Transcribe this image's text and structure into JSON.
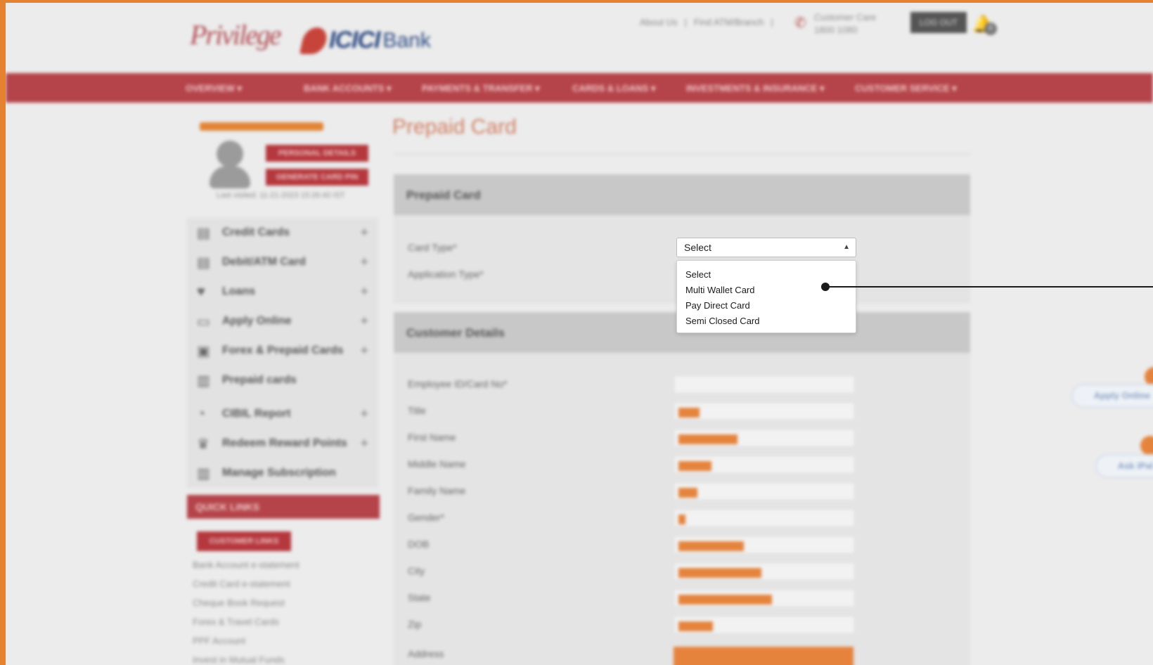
{
  "header": {
    "logo_privilege": "Privilege",
    "logo_bank": "ICICI",
    "logo_bank_suffix": "Bank",
    "about_link": "About Us",
    "find_link": "Find ATM/Branch",
    "care_label": "Customer Care",
    "care_number": "1800 1080",
    "logout_label": "LOG OUT",
    "notification_count": "0"
  },
  "nav": {
    "items": [
      {
        "label": "OVERVIEW ▾"
      },
      {
        "label": "BANK ACCOUNTS ▾"
      },
      {
        "label": "PAYMENTS & TRANSFER ▾"
      },
      {
        "label": "CARDS & LOANS ▾"
      },
      {
        "label": "INVESTMENTS & INSURANCE ▾"
      },
      {
        "label": "CUSTOMER SERVICE ▾"
      }
    ]
  },
  "profile": {
    "personal_details_label": "PERSONAL DETAILS",
    "generate_pin_label": "GENERATE CARD PIN",
    "last_visited": "Last visited: 11-21-2023 15:26:40 IST"
  },
  "sidebar": {
    "items": [
      {
        "label": "Credit Cards",
        "icon": "cards-icon",
        "expand": "+"
      },
      {
        "label": "Debit/ATM Card",
        "icon": "cards-icon",
        "expand": "+"
      },
      {
        "label": "Loans",
        "icon": "handshake-icon",
        "expand": "+"
      },
      {
        "label": "Apply Online",
        "icon": "monitor-icon",
        "expand": "+"
      },
      {
        "label": "Forex & Prepaid Cards",
        "icon": "wallet-icon",
        "expand": "+"
      },
      {
        "label": "Prepaid cards",
        "icon": "card-icon",
        "expand": ""
      },
      {
        "label": "CIBIL Report",
        "icon": "gauge-icon",
        "expand": "+"
      },
      {
        "label": "Redeem Reward Points",
        "icon": "trophy-icon",
        "expand": "+"
      },
      {
        "label": "Manage Subscription",
        "icon": "card-icon",
        "expand": ""
      }
    ],
    "quick_links_title": "QUICK LINKS",
    "customer_links_label": "CUSTOMER LINKS",
    "quick_links": [
      "Bank Account e-statement",
      "Credit Card e-statement",
      "Cheque Book Request",
      "Forex & Travel Cards",
      "PPF Account",
      "Invest in Mutual Funds"
    ]
  },
  "main": {
    "page_title": "Prepaid Card",
    "card_section_title": "Prepaid Card",
    "card_type_label": "Card Type*",
    "application_type_label": "Application Type*",
    "card_type_select": {
      "value": "Select",
      "options": [
        "Select",
        "Multi Wallet Card",
        "Pay Direct Card",
        "Semi Closed Card"
      ]
    },
    "customer_section_title": "Customer Details",
    "customer_fields": [
      {
        "label": "Employee ID/Card No*",
        "fill": 0
      },
      {
        "label": "Title",
        "fill": 0.12
      },
      {
        "label": "First Name",
        "fill": 0.34
      },
      {
        "label": "Middle Name",
        "fill": 0.19
      },
      {
        "label": "Family Name",
        "fill": 0.11
      },
      {
        "label": "Gender*",
        "fill": 0.04
      },
      {
        "label": "DOB",
        "fill": 0.38
      },
      {
        "label": "City",
        "fill": 0.48
      },
      {
        "label": "State",
        "fill": 0.54
      },
      {
        "label": "Zip",
        "fill": 0.2
      }
    ],
    "address_label": "Address"
  },
  "floating": {
    "apply_online_label": "Apply Online",
    "ask_ipal_label": "Ask iPal"
  },
  "colors": {
    "frame": "#e58231",
    "nav_red": "#b5444a",
    "redaction_orange": "#e5833d"
  }
}
